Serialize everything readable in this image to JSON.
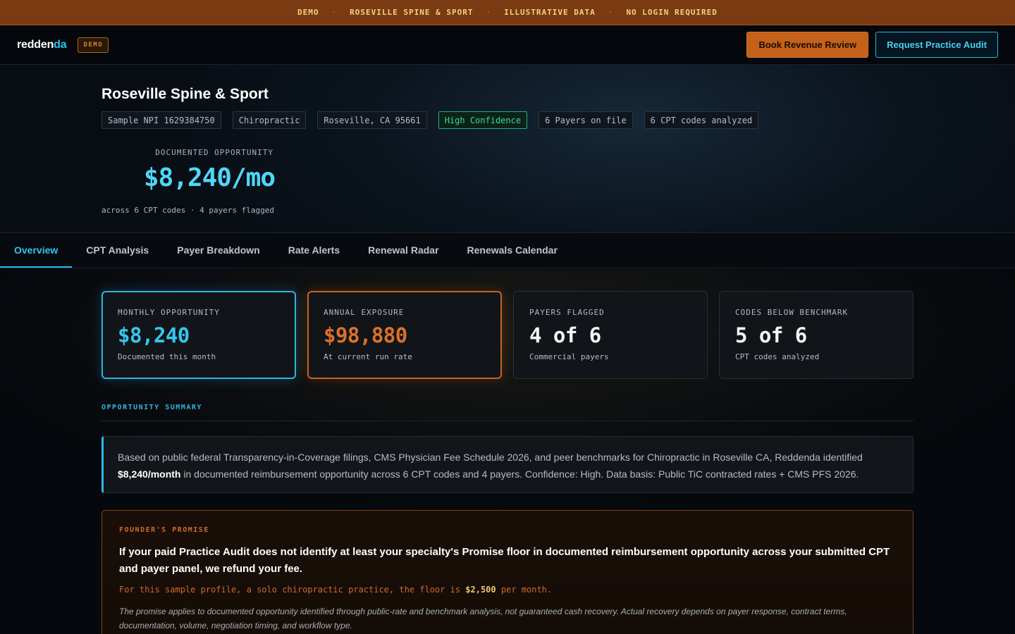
{
  "banner": {
    "items": [
      "DEMO",
      "ROSEVILLE SPINE & SPORT",
      "ILLUSTRATIVE DATA",
      "NO LOGIN REQUIRED"
    ],
    "separator": "·"
  },
  "nav": {
    "logo_main": "redden",
    "logo_accent": "da",
    "demo_badge": "DEMO",
    "book_button": "Book Revenue Review",
    "audit_button": "Request Practice Audit"
  },
  "hero": {
    "title": "Roseville Spine & Sport",
    "chips": [
      "Sample NPI 1629384750",
      "Chiropractic",
      "Roseville, CA 95661",
      "High Confidence",
      "6 Payers on file",
      "6 CPT codes analyzed"
    ],
    "opportunity_label": "DOCUMENTED OPPORTUNITY",
    "opportunity_value": "$8,240/mo",
    "opportunity_sub": "across 6 CPT codes · 4 payers flagged"
  },
  "tabs": [
    "Overview",
    "CPT Analysis",
    "Payer Breakdown",
    "Rate Alerts",
    "Renewal Radar",
    "Renewals Calendar"
  ],
  "kpis": [
    {
      "label": "MONTHLY OPPORTUNITY",
      "value": "$8,240",
      "sub": "Documented this month"
    },
    {
      "label": "ANNUAL EXPOSURE",
      "value": "$98,880",
      "sub": "At current run rate"
    },
    {
      "label": "PAYERS FLAGGED",
      "value": "4 of 6",
      "sub": "Commercial payers"
    },
    {
      "label": "CODES BELOW BENCHMARK",
      "value": "5 of 6",
      "sub": "CPT codes analyzed"
    }
  ],
  "summary": {
    "section_title": "OPPORTUNITY SUMMARY",
    "text_before": "Based on public federal Transparency-in-Coverage filings, CMS Physician Fee Schedule 2026, and peer benchmarks for Chiropractic in Roseville CA, Reddenda identified ",
    "highlight": "$8,240/month",
    "text_after": " in documented reimbursement opportunity across 6 CPT codes and 4 payers. Confidence: High. Data basis: Public TiC contracted rates + CMS PFS 2026."
  },
  "promise": {
    "label": "FOUNDER'S PROMISE",
    "headline": "If your paid Practice Audit does not identify at least your specialty's Promise floor in documented reimbursement opportunity across your submitted CPT and payer panel, we refund your fee.",
    "floor_before": "For this sample profile, a solo chiropractic practice, the floor is ",
    "floor_value": "$2,500",
    "floor_after": " per month.",
    "note": "The promise applies to documented opportunity identified through public-rate and benchmark analysis, not guaranteed cash recovery. Actual recovery depends on payer response, contract terms, documentation, volume, negotiation timing, and workflow type."
  },
  "colors": {
    "accent_blue": "#29b8e6",
    "accent_orange": "#c4611a",
    "banner_bg": "#7a3a12",
    "confidence_green": "#1fae7a"
  }
}
